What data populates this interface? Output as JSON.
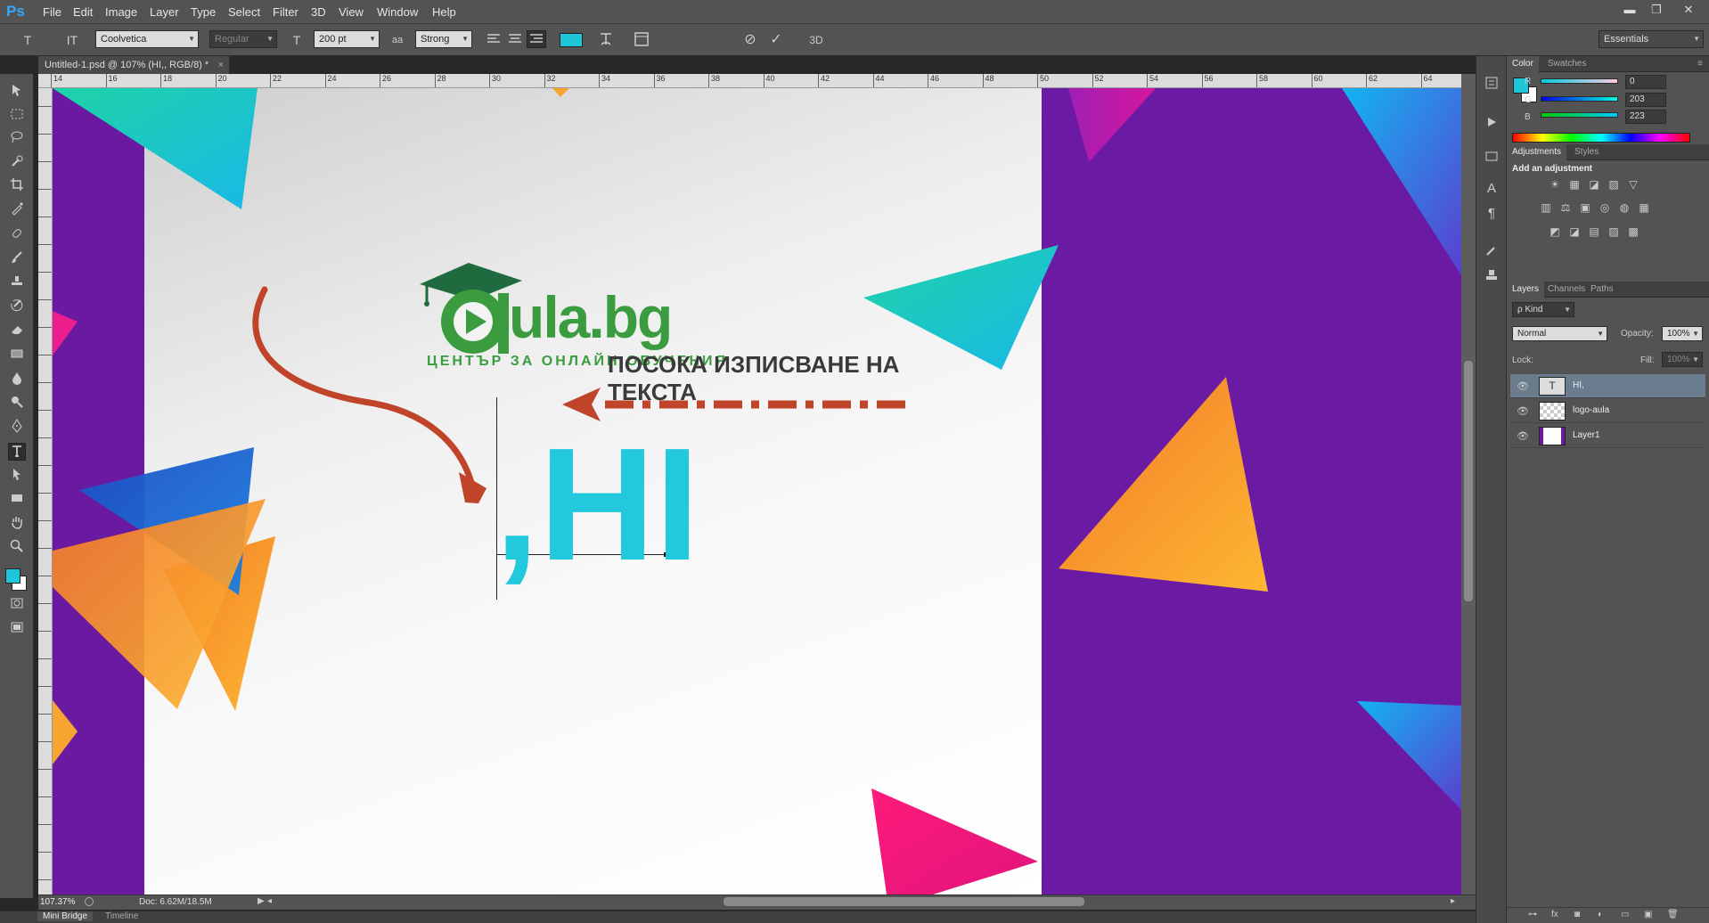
{
  "app": {
    "logo": "Ps"
  },
  "menu": [
    "File",
    "Edit",
    "Image",
    "Layer",
    "Type",
    "Select",
    "Filter",
    "3D",
    "View",
    "Window",
    "Help"
  ],
  "window_controls": {
    "minimize": "▬",
    "restore": "❐",
    "close": "✕"
  },
  "options": {
    "font_family": "Coolvetica",
    "font_style": "Regular",
    "font_size": "200 pt",
    "antialias": "Strong",
    "text_color": "#1fc6da",
    "workspace": "Essentials",
    "tool_icon": "T",
    "orient_icon": "IT",
    "size_icon": "T",
    "aa_icon": "aa",
    "cancel_icon": "⊘",
    "commit_icon": "✓",
    "three_d": "3D"
  },
  "document_tab": {
    "title": "Untitled-1.psd @ 107% (HI,, RGB/8) *",
    "close": "×"
  },
  "ruler_ticks": [
    "14",
    "16",
    "18",
    "20",
    "22",
    "24",
    "26",
    "28",
    "30",
    "32",
    "34",
    "36",
    "38",
    "40",
    "42",
    "44",
    "46",
    "48",
    "50",
    "52",
    "54",
    "56",
    "58",
    "60",
    "62",
    "64"
  ],
  "canvas": {
    "logo_text": "ula.bg",
    "logo_subtitle": "ЦЕНТЪР ЗА ОНЛАЙН ОБУЧЕНИЯ",
    "annotation_line1": "ПОСОКА ИЗПИСВАНЕ НА",
    "annotation_line2": "ТЕКСТА",
    "typed_text": "HI",
    "typed_comma": ","
  },
  "status": {
    "zoom": "107.37%",
    "doc": "Doc: 6.62M/18.5M",
    "arrow": "▶",
    "left": "◂",
    "right": "▸"
  },
  "bottom_tabs": [
    "Mini Bridge",
    "Timeline"
  ],
  "color_panel": {
    "tabs": [
      "Color",
      "Swatches"
    ],
    "fg": "#1fc6da",
    "channels": [
      {
        "label": "R",
        "value": "0"
      },
      {
        "label": "G",
        "value": "203"
      },
      {
        "label": "B",
        "value": "223"
      }
    ],
    "menu_icon": "≡"
  },
  "adjustments_panel": {
    "tabs": [
      "Adjustments",
      "Styles"
    ],
    "hint": "Add an adjustment",
    "icons": [
      "☀",
      "▦",
      "◪",
      "▨",
      "▽",
      "▥",
      "⚖",
      "▣",
      "◎",
      "◍",
      "▦",
      "◩",
      "◪",
      "▤",
      "▨",
      "▩"
    ]
  },
  "layers_panel": {
    "tabs": [
      "Layers",
      "Channels",
      "Paths"
    ],
    "kind": "ρ Kind",
    "blend_mode": "Normal",
    "opacity_label": "Opacity:",
    "opacity": "100%",
    "lock_label": "Lock:",
    "fill_label": "Fill:",
    "fill": "100%",
    "layers": [
      {
        "name": "HI,",
        "thumb": "T",
        "selected": true
      },
      {
        "name": "logo-aula",
        "thumb": "",
        "selected": false
      },
      {
        "name": "Layer1",
        "thumb": "",
        "selected": false
      }
    ],
    "footer_icons": [
      "⊶",
      "fx",
      "◙",
      "◐",
      "▭",
      "▣",
      "🗑"
    ]
  }
}
